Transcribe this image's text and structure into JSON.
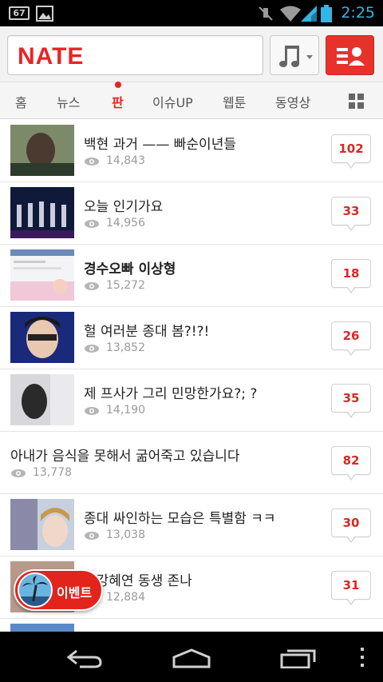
{
  "status_bar": {
    "badge": "67",
    "time": "2:25"
  },
  "header": {
    "logo": "NATE",
    "music_icon": "music-note-icon",
    "profile_icon": "menu-person-icon",
    "brand_color": "#e6322b"
  },
  "tabs": [
    {
      "label": "홈"
    },
    {
      "label": "뉴스"
    },
    {
      "label": "판"
    },
    {
      "label": "이슈UP"
    },
    {
      "label": "웹툰"
    },
    {
      "label": "동영상"
    }
  ],
  "active_tab": "판",
  "posts": [
    {
      "title": "백현 과거 —— 빠순이년들",
      "views": "14,843",
      "comments": "102",
      "bold": false
    },
    {
      "title": "오늘 인기가요",
      "views": "14,956",
      "comments": "33",
      "bold": false
    },
    {
      "title": "경수오빠 이상형",
      "views": "15,272",
      "comments": "18",
      "bold": true
    },
    {
      "title": "헐 여러분 종대 봄?!?!",
      "views": "13,852",
      "comments": "26",
      "bold": false
    },
    {
      "title": "제 프사가 그리 민망한가요?; ?",
      "views": "14,190",
      "comments": "35",
      "bold": false
    },
    {
      "title": "아내가 음식을 못해서 굶어죽고 있습니다",
      "views": "13,778",
      "comments": "82",
      "bold": false
    },
    {
      "title": "종대 싸인하는 모습은 특별함 ㅋㅋ",
      "views": "13,038",
      "comments": "30",
      "bold": false
    },
    {
      "title": "짱강혜연 동생 존나",
      "views": "12,884",
      "comments": "31",
      "bold": false
    }
  ],
  "event_button": {
    "label": "이벤트"
  }
}
